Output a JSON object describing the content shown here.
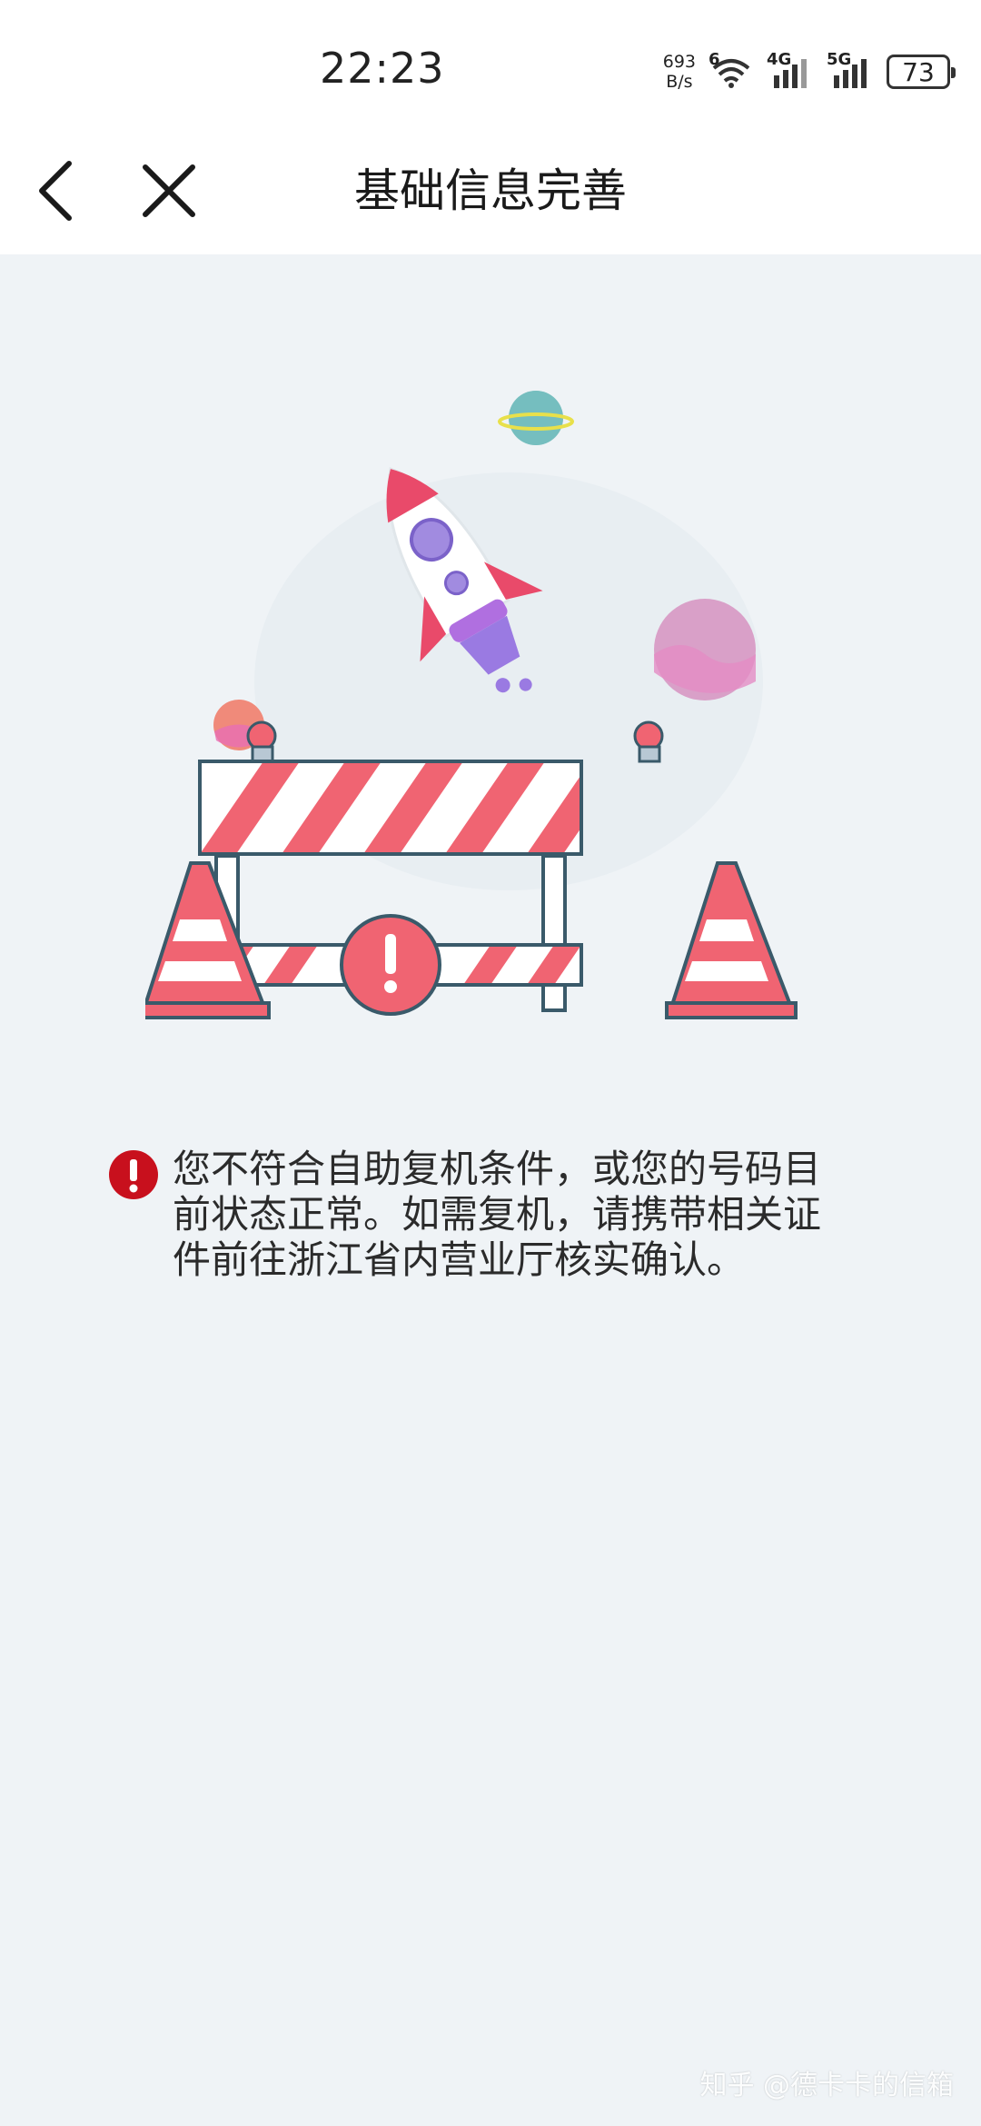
{
  "status_bar": {
    "time": "22:23",
    "net_speed_value": "693",
    "net_speed_unit": "B/s",
    "wifi_label": "6",
    "signal1_label": "4G",
    "signal2_label": "5G",
    "battery": "73"
  },
  "nav": {
    "title": "基础信息完善",
    "back_icon": "chevron-left-icon",
    "close_icon": "close-icon"
  },
  "message": {
    "text": "您不符合自助复机条件，或您的号码目前状态正常。如需复机，请携带相关证件前往浙江省内营业厅核实确认。",
    "icon": "alert-icon",
    "icon_color": "#c8101d"
  },
  "watermark": "知乎 @德卡卡的信箱",
  "colors": {
    "accent_red": "#f06472",
    "background": "#eff3f6"
  }
}
